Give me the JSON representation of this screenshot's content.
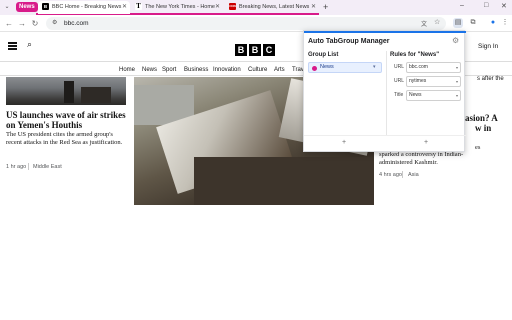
{
  "tabs": {
    "group_label": "News",
    "items": [
      {
        "title": "BBC Home - Breaking News",
        "favicon": "B"
      },
      {
        "title": "The New York Times - Home",
        "favicon": "T"
      },
      {
        "title": "Breaking News, Latest News",
        "favicon": "CNN"
      }
    ],
    "new_tab": "+"
  },
  "toolbar": {
    "back": "←",
    "forward": "→",
    "reload": "↻",
    "url": "bbc.com",
    "minimize": "–",
    "maximize": "□",
    "close": "✕"
  },
  "bbc": {
    "logo": [
      "B",
      "B",
      "C"
    ],
    "sign_in": "Sign In",
    "nav": [
      "Home",
      "News",
      "Sport",
      "Business",
      "Innovation",
      "Culture",
      "Arts",
      "Trav"
    ],
    "left_story": {
      "headline": "US launches wave of air strikes on Yemen's Houthis",
      "summary": "The US president cites the armed group's recent attacks in the Red Sea as justification.",
      "time": "1 hr ago",
      "section": "Middle East"
    },
    "right_story": {
      "headline_fragment_1": "s after the",
      "headline_fragment_2": "asion? A",
      "headline_fragment_3": "w in",
      "summary_fragment_1": "es",
      "summary_fragment_2": "sparked a controversy in Indian-administered Kashmir.",
      "time": "4 hrs ago",
      "section": "Asia"
    }
  },
  "popup": {
    "title": "Auto TabGroup Manager",
    "group_list_title": "Group List",
    "rules_title": "Rules for \"News\"",
    "selected_group": "News",
    "rules": [
      {
        "label": "URL",
        "value": "bbc.com"
      },
      {
        "label": "URL",
        "value": "nytimes"
      },
      {
        "label": "Title",
        "value": "News"
      }
    ],
    "add_group": "+",
    "add_rule": "+"
  },
  "colors": {
    "group": "#d81b8a",
    "accent": "#1a73e8"
  }
}
